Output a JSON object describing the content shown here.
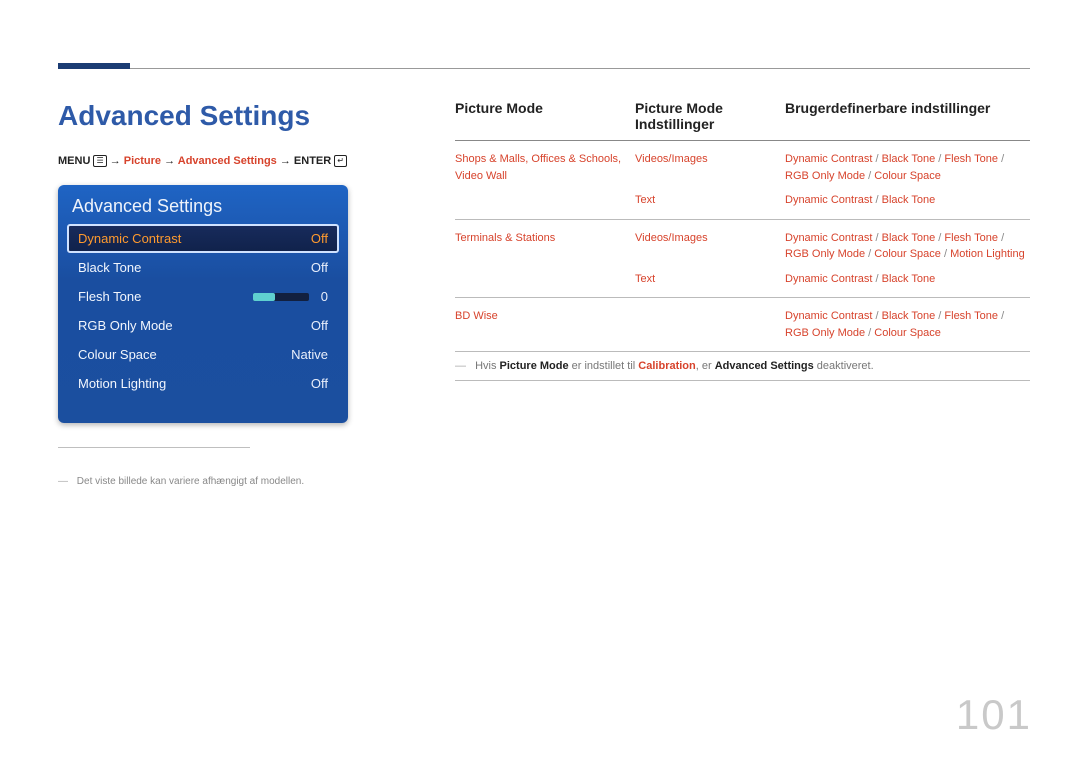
{
  "title": "Advanced Settings",
  "breadcrumb": {
    "menu": "MENU",
    "menuIcon": "☰",
    "arrow": " → ",
    "picture": "Picture",
    "advset": "Advanced Settings",
    "enter": "ENTER",
    "enterIcon": "↵"
  },
  "panel": {
    "header": "Advanced Settings",
    "rows": [
      {
        "label": "Dynamic Contrast",
        "value": "Off",
        "selected": true
      },
      {
        "label": "Black Tone",
        "value": "Off"
      },
      {
        "label": "Flesh Tone",
        "value": "0",
        "slider": 0
      },
      {
        "label": "RGB Only Mode",
        "value": "Off"
      },
      {
        "label": "Colour Space",
        "value": "Native"
      },
      {
        "label": "Motion Lighting",
        "value": "Off"
      }
    ]
  },
  "footnote": "Det viste billede kan variere afhængigt af modellen.",
  "table": {
    "head": {
      "c1": "Picture Mode",
      "c2": "Picture Mode Indstillinger",
      "c3": "Brugerdefinerbare indstillinger"
    },
    "rows": [
      {
        "c1": "Shops & Malls, Offices & Schools, Video Wall",
        "c2a": "Videos/Images",
        "c3a": "Dynamic Contrast / Black Tone / Flesh Tone / RGB Only Mode / Colour Space",
        "c2b": "Text",
        "c3b": "Dynamic Contrast / Black Tone"
      },
      {
        "c1": "Terminals & Stations",
        "c2a": "Videos/Images",
        "c3a": "Dynamic Contrast / Black Tone / Flesh Tone / RGB Only Mode / Colour Space / Motion Lighting",
        "c2b": "Text",
        "c3b": "Dynamic Contrast / Black Tone"
      },
      {
        "c1": "BD Wise",
        "c2a": "",
        "c3a": "Dynamic Contrast / Black Tone / Flesh Tone / RGB Only Mode / Colour Space"
      }
    ],
    "note": {
      "dash": "―",
      "p1": "Hvis ",
      "pm": "Picture Mode",
      "p2": " er indstillet til ",
      "cal": "Calibration",
      "p3": ", er ",
      "as": "Advanced Settings",
      "p4": " deaktiveret."
    }
  },
  "page": "101"
}
